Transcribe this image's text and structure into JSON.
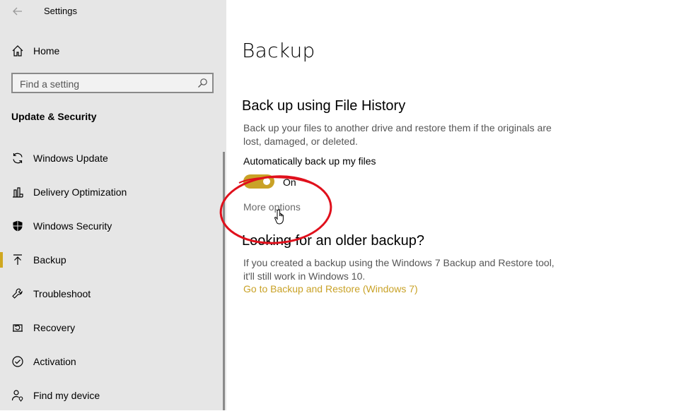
{
  "window": {
    "title": "Settings"
  },
  "sidebar": {
    "home": {
      "label": "Home",
      "icon": "home-icon"
    },
    "search": {
      "placeholder": "Find a setting",
      "icon": "search-icon"
    },
    "section_title": "Update & Security",
    "items": [
      {
        "label": "Windows Update",
        "icon": "refresh-icon"
      },
      {
        "label": "Delivery Optimization",
        "icon": "delivery-icon"
      },
      {
        "label": "Windows Security",
        "icon": "shield-icon"
      },
      {
        "label": "Backup",
        "icon": "upload-arrow-icon",
        "active": true
      },
      {
        "label": "Troubleshoot",
        "icon": "wrench-icon"
      },
      {
        "label": "Recovery",
        "icon": "recovery-icon"
      },
      {
        "label": "Activation",
        "icon": "check-circle-icon"
      },
      {
        "label": "Find my device",
        "icon": "person-location-icon"
      }
    ]
  },
  "main": {
    "title": "Backup",
    "file_history": {
      "heading": "Back up using File History",
      "description": "Back up your files to another drive and restore them if the originals are lost, damaged, or deleted.",
      "toggle_label": "Automatically back up my files",
      "toggle_state": "On",
      "more_options": "More options"
    },
    "older_backup": {
      "heading": "Looking for an older backup?",
      "description": "If you created a backup using the Windows 7 Backup and Restore tool, it'll still work in Windows 10.",
      "link": "Go to Backup and Restore (Windows 7)"
    }
  },
  "colors": {
    "accent": "#c9a227",
    "sidebar_bg": "#e6e6e6",
    "annotation": "#e0101c"
  }
}
